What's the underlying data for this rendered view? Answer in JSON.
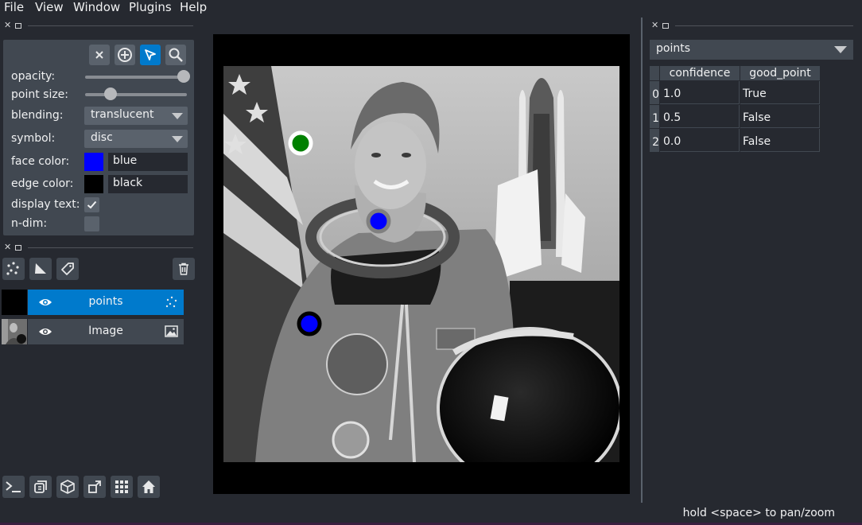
{
  "menu": [
    "File",
    "View",
    "Window",
    "Plugins",
    "Help"
  ],
  "controls": {
    "labels": {
      "opacity": "opacity:",
      "point_size": "point size:",
      "blending": "blending:",
      "symbol": "symbol:",
      "face_color": "face color:",
      "edge_color": "edge color:",
      "display_text": "display text:",
      "n_dim": "n-dim:"
    },
    "opacity": 1.0,
    "point_size_fraction": 0.23,
    "blending": "translucent",
    "symbol": "disc",
    "face_color": "blue",
    "edge_color": "black",
    "face_color_hex": "#0000ff",
    "edge_color_hex": "#000000",
    "display_text": true,
    "n_dim": false,
    "mode": "select",
    "tool_icons": [
      "delete-selected-icon",
      "add-points-icon",
      "select-points-icon",
      "pan-zoom-icon"
    ]
  },
  "layers": [
    {
      "name": "points",
      "visible": true,
      "selected": true
    },
    {
      "name": "Image",
      "visible": true,
      "selected": false
    }
  ],
  "layer_buttons": [
    "new-points-icon",
    "new-shapes-icon",
    "new-labels-icon",
    "delete-layer-icon"
  ],
  "bottom_buttons": [
    "console-icon",
    "ndisplay-icon",
    "roll-dims-icon",
    "transpose-icon",
    "grid-icon",
    "home-icon"
  ],
  "points_on_canvas": [
    {
      "face": "#008000",
      "edge": "#ffffff"
    },
    {
      "face": "#0000ff",
      "edge": "#808080"
    },
    {
      "face": "#0000ff",
      "edge": "#000000"
    }
  ],
  "features": {
    "layer": "points",
    "columns": [
      "confidence",
      "good_point"
    ],
    "rows": [
      {
        "index": "0",
        "confidence": "1.0",
        "good_point": "True"
      },
      {
        "index": "1",
        "confidence": "0.5",
        "good_point": "False"
      },
      {
        "index": "2",
        "confidence": "0.0",
        "good_point": "False"
      }
    ]
  },
  "status": "hold <space> to pan/zoom",
  "colors": {
    "background": "#262930",
    "panel": "#414851",
    "button": "#5a626c",
    "accent": "#007acc"
  }
}
